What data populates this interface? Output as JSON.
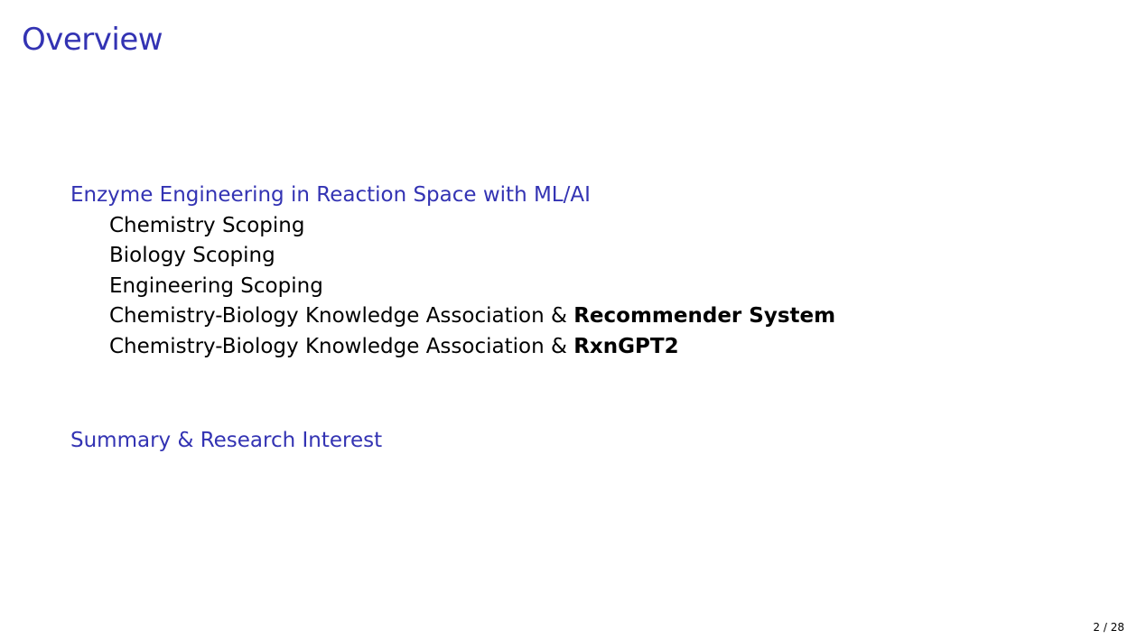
{
  "slide": {
    "title": "Overview",
    "page_number": "2 / 28"
  },
  "toc": {
    "sections": [
      {
        "label": "Enzyme Engineering in Reaction Space with ML/AI",
        "subsections": [
          {
            "text": "Chemistry Scoping",
            "bold": ""
          },
          {
            "text": "Biology Scoping",
            "bold": ""
          },
          {
            "text": "Engineering Scoping",
            "bold": ""
          },
          {
            "text": "Chemistry-Biology Knowledge Association & ",
            "bold": "Recommender System"
          },
          {
            "text": "Chemistry-Biology Knowledge Association & ",
            "bold": "RxnGPT2"
          }
        ]
      },
      {
        "label": "Summary & Research Interest",
        "subsections": []
      }
    ]
  },
  "colors": {
    "accent": "#3333b3",
    "text": "#000000",
    "background": "#ffffff"
  }
}
